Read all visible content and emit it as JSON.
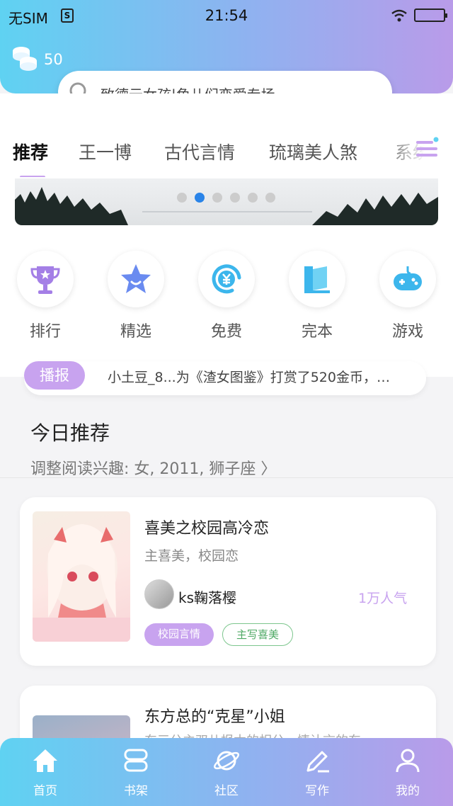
{
  "status_bar": {
    "carrier": "无SIM",
    "time": "21:54"
  },
  "header": {
    "coins": "50",
    "search_placeholder": "致德云女孩|角儿们恋爱专场"
  },
  "tabs": [
    "推荐",
    "王一博",
    "古代言情",
    "琉璃美人煞",
    "系统"
  ],
  "banner": {
    "page_count": 6,
    "active_index": 1
  },
  "categories": [
    {
      "label": "排行",
      "icon": "trophy-icon"
    },
    {
      "label": "精选",
      "icon": "star-icon"
    },
    {
      "label": "免费",
      "icon": "yen-coin-icon"
    },
    {
      "label": "完本",
      "icon": "book-icon"
    },
    {
      "label": "游戏",
      "icon": "gamepad-icon"
    }
  ],
  "broadcast": {
    "tag": "播报",
    "text": "小土豆_8...为《渣女图鉴》打赏了520金币，…"
  },
  "today": {
    "title": "今日推荐",
    "subtitle": "调整阅读兴趣: 女, 2011, 狮子座 〉"
  },
  "books": [
    {
      "title": "喜美之校园高冷恋",
      "desc": "主喜美，校园恋",
      "author": "ks鞠落樱",
      "popularity": "1万人气",
      "tags": [
        "校园言情",
        "主写喜美"
      ]
    },
    {
      "title": "东方总的“克星”小姐",
      "desc": "东三公主双儿报木的相公，情让言的东"
    }
  ],
  "bottom_nav": [
    {
      "label": "首页",
      "icon": "home-icon"
    },
    {
      "label": "书架",
      "icon": "bookshelf-icon"
    },
    {
      "label": "社区",
      "icon": "planet-icon"
    },
    {
      "label": "写作",
      "icon": "pen-icon"
    },
    {
      "label": "我的",
      "icon": "user-icon"
    }
  ],
  "colors": {
    "accent_purple": "#c8a3ef",
    "accent_blue": "#2a84e8",
    "tag_green": "#7cc68d"
  }
}
